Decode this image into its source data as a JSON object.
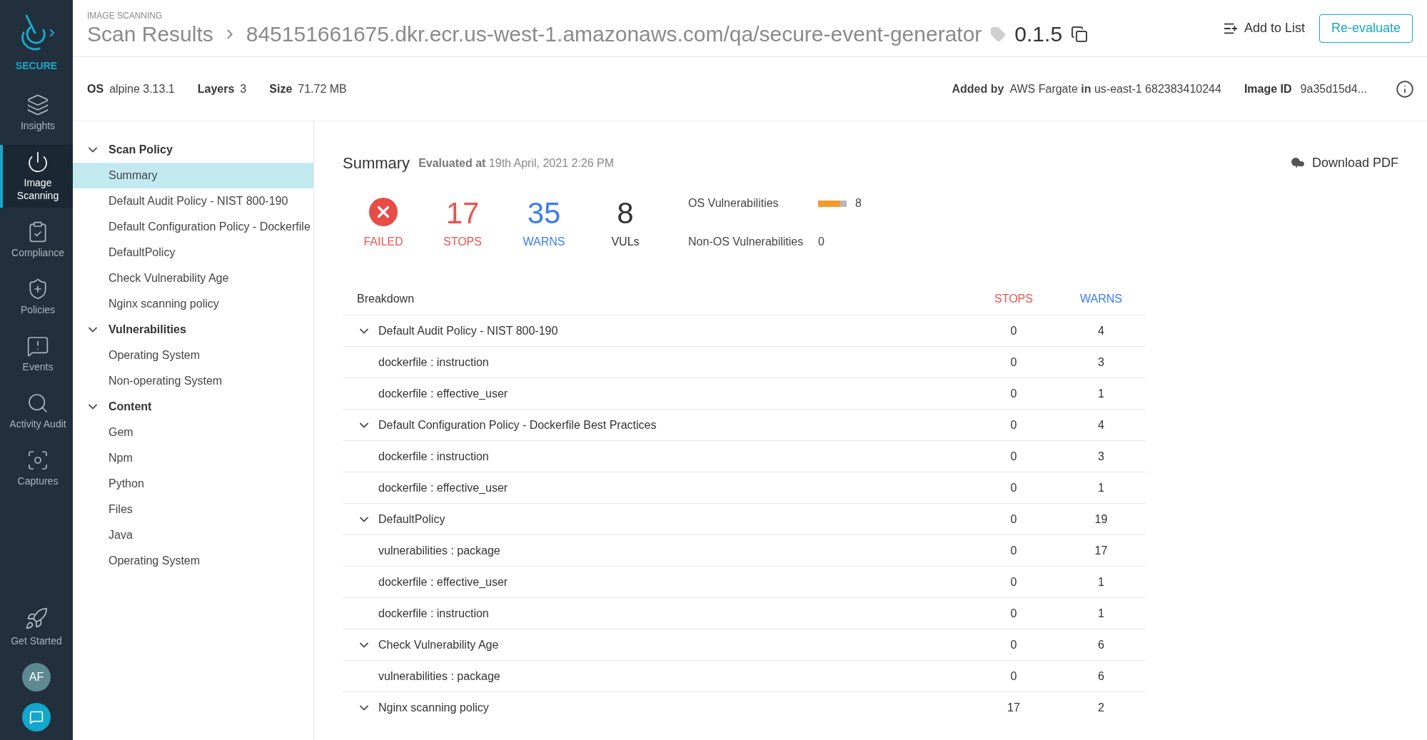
{
  "rail": {
    "brand": "SECURE",
    "items": [
      {
        "label": "Insights",
        "kind": "insights",
        "selected": false
      },
      {
        "label": "Image Scanning",
        "kind": "scanning",
        "selected": true
      },
      {
        "label": "Compliance",
        "kind": "compliance",
        "selected": false
      },
      {
        "label": "Policies",
        "kind": "policies",
        "selected": false
      },
      {
        "label": "Events",
        "kind": "events",
        "selected": false
      },
      {
        "label": "Activity Audit",
        "kind": "audit",
        "selected": false
      },
      {
        "label": "Captures",
        "kind": "captures",
        "selected": false
      }
    ],
    "get_started": "Get Started",
    "avatar": "AF"
  },
  "header": {
    "eyebrow": "IMAGE SCANNING",
    "title": "Scan Results",
    "path": "845151661675.dkr.ecr.us-west-1.amazonaws.com/qa/secure-event-generator",
    "tag": "0.1.5",
    "add_to_list": "Add to List",
    "reevaluate": "Re-evaluate"
  },
  "info": {
    "facts": [
      {
        "label": "OS",
        "value": "alpine 3.13.1"
      },
      {
        "label": "Layers",
        "value": "3"
      },
      {
        "label": "Size",
        "value": "71.72 MB"
      }
    ],
    "added_by": "**Added by**  AWS Fargate **in** us-east-1 682383410244",
    "image_id_label": "Image ID",
    "image_id": "9a35d15d4..."
  },
  "nav": [
    {
      "label": "Scan Policy",
      "expanded": true,
      "children": [
        {
          "label": "Summary",
          "selected": true
        },
        {
          "label": "Default Audit Policy - NIST 800-190",
          "selected": false
        },
        {
          "label": "Default Configuration Policy - Dockerfile",
          "selected": false
        },
        {
          "label": "DefaultPolicy",
          "selected": false
        },
        {
          "label": "Check Vulnerability Age",
          "selected": false
        },
        {
          "label": "Nginx scanning policy",
          "selected": false
        }
      ]
    },
    {
      "label": "Vulnerabilities",
      "expanded": true,
      "children": [
        {
          "label": "Operating System",
          "selected": false
        },
        {
          "label": "Non-operating System",
          "selected": false
        }
      ]
    },
    {
      "label": "Content",
      "expanded": true,
      "children": [
        {
          "label": "Gem",
          "selected": false
        },
        {
          "label": "Npm",
          "selected": false
        },
        {
          "label": "Python",
          "selected": false
        },
        {
          "label": "Files",
          "selected": false
        },
        {
          "label": "Java",
          "selected": false
        },
        {
          "label": "Operating System",
          "selected": false
        }
      ]
    }
  ],
  "summary": {
    "title": "Summary",
    "evaluated": "**Evaluated at** 19th April, 2021 2:26 PM",
    "download": "Download PDF",
    "status": {
      "kind": "failed",
      "label": "FAILED"
    },
    "stats": [
      {
        "kind": "stops",
        "value": "17",
        "label": "STOPS"
      },
      {
        "kind": "warns",
        "value": "35",
        "label": "WARNS"
      },
      {
        "kind": "vulns",
        "value": "8",
        "label": "VULs"
      }
    ],
    "vulnerabilities": [
      {
        "label": "OS Vulnerabilities",
        "count": "8",
        "level": 0.78
      },
      {
        "label": "Non-OS Vulnerabilities",
        "count": "0"
      }
    ]
  },
  "breakdown": {
    "columns": [
      "Breakdown",
      "STOPS",
      "WARNS"
    ],
    "rows": [
      {
        "label": "Default Audit Policy - NIST 800-190",
        "stops": "0",
        "warns": "4",
        "expanded": true,
        "children": [
          {
            "label": "dockerfile : instruction",
            "stops": "0",
            "warns": "3"
          },
          {
            "label": "dockerfile : effective_user",
            "stops": "0",
            "warns": "1"
          }
        ]
      },
      {
        "label": "Default Configuration Policy - Dockerfile Best Practices",
        "stops": "0",
        "warns": "4",
        "expanded": true,
        "children": [
          {
            "label": "dockerfile : instruction",
            "stops": "0",
            "warns": "3"
          },
          {
            "label": "dockerfile : effective_user",
            "stops": "0",
            "warns": "1"
          }
        ]
      },
      {
        "label": "DefaultPolicy",
        "stops": "0",
        "warns": "19",
        "expanded": true,
        "children": [
          {
            "label": "vulnerabilities : package",
            "stops": "0",
            "warns": "17"
          },
          {
            "label": "dockerfile : effective_user",
            "stops": "0",
            "warns": "1"
          },
          {
            "label": "dockerfile : instruction",
            "stops": "0",
            "warns": "1"
          }
        ]
      },
      {
        "label": "Check Vulnerability Age",
        "stops": "0",
        "warns": "6",
        "expanded": true,
        "children": [
          {
            "label": "vulnerabilities : package",
            "stops": "0",
            "warns": "6"
          }
        ]
      },
      {
        "label": "Nginx scanning policy",
        "stops": "17",
        "warns": "2",
        "expanded": true,
        "children": []
      }
    ]
  }
}
